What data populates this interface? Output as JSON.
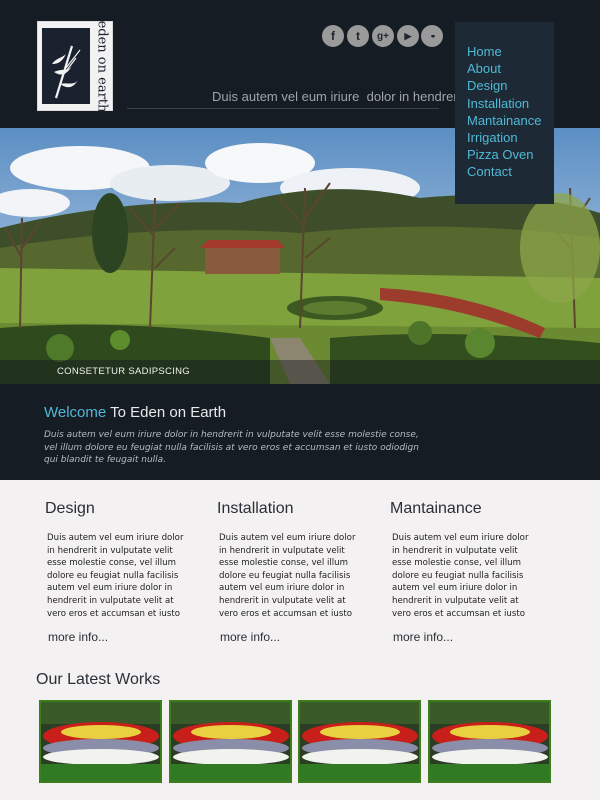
{
  "brand": {
    "logo_text": "eden on earth"
  },
  "header": {
    "tagline": "Duis autem vel eum iriure  dolor in hendrerit",
    "social": [
      {
        "name": "facebook-icon",
        "glyph": "f"
      },
      {
        "name": "twitter-icon",
        "glyph": "t"
      },
      {
        "name": "google-plus-icon",
        "glyph": "g+"
      },
      {
        "name": "youtube-icon",
        "glyph": "▶"
      },
      {
        "name": "flickr-icon",
        "glyph": "••"
      }
    ]
  },
  "nav": {
    "items": [
      "Home",
      "About",
      "Design",
      "Installation",
      "Mantainance",
      "Irrigation",
      "Pizza Oven",
      "Contact"
    ]
  },
  "hero": {
    "caption": "CONSETETUR SADIPSCING"
  },
  "welcome": {
    "title_accent": "Welcome",
    "title_rest": " To Eden on Earth",
    "body": "Duis autem vel eum iriure dolor in hendrerit in vulputate velit esse molestie conse,\nvel illum dolore eu feugiat nulla facilisis at vero eros et accumsan et iusto odiodign\nqui blandit  te feugait nulla."
  },
  "columns": [
    {
      "title": "Design",
      "body": "Duis autem vel eum iriure dolor\nin hendrerit in vulputate velit\nesse molestie conse, vel illum\ndolore eu feugiat nulla facilisis\nautem vel eum iriure dolor in\nhendrerit in vulputate velit  at\nvero eros et accumsan et iusto",
      "more": "more info..."
    },
    {
      "title": "Installation",
      "body": "Duis autem vel eum iriure dolor\nin hendrerit in vulputate velit\nesse molestie conse, vel illum\ndolore eu feugiat nulla facilisis\nautem vel eum iriure dolor in\nhendrerit in vulputate velit  at\nvero eros et accumsan et iusto",
      "more": "more info..."
    },
    {
      "title": "Mantainance",
      "body": "Duis autem vel eum iriure dolor\nin hendrerit in vulputate velit\nesse molestie conse, vel illum\ndolore eu feugiat nulla facilisis\nautem vel eum iriure dolor in\nhendrerit in vulputate velit  at\nvero eros et accumsan et iusto",
      "more": "more info..."
    }
  ],
  "works": {
    "title": "Our Latest Works",
    "count": 4
  },
  "colors": {
    "header_bg": "#161c24",
    "nav_bg": "#1e2936",
    "accent": "#4fb9d6",
    "page_bg": "#f3f1f1",
    "thumb_border": "#3e7d1c"
  }
}
